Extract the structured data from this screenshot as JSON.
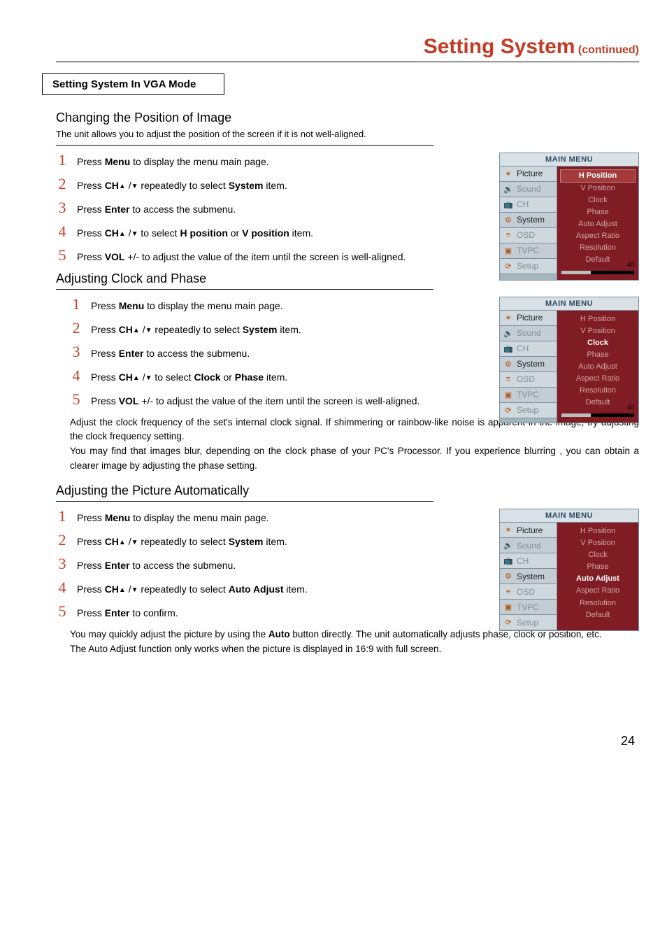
{
  "title": {
    "main": "Setting System",
    "sub": "(continued)"
  },
  "box_heading": "Setting System In VGA Mode",
  "section1": {
    "heading": "Changing the Position of Image",
    "intro": "The unit allows you to adjust the position of the screen if it is not well-aligned."
  },
  "section2": {
    "heading": "Adjusting Clock and Phase",
    "note1": "Adjust the clock frequency of the set's internal clock signal. If shimmering or rainbow-like noise is apparent in the image, try adjusting the clock frequency setting.",
    "note2": "You may find that images blur, depending on the clock phase of your PC's Processor. If you experience blurring , you can obtain a clearer image by adjusting the phase setting."
  },
  "section3": {
    "heading": "Adjusting the Picture Automatically",
    "note1_a": "You may quickly adjust the picture by using the ",
    "note1_bold": "Auto",
    "note1_b": " button directly. The unit automatically adjusts phase, clock or position, etc.",
    "note2": "The Auto Adjust function only works when the picture is displayed in 16:9 with full screen."
  },
  "steps_common": {
    "s1_a": "Press  ",
    "s1_bold": "Menu",
    "s1_b": " to display the menu main page.",
    "s2_a": "Press ",
    "s2_bold1": "CH",
    "s2_mid": " /",
    "s2_b": "  repeatedly to select ",
    "s2_bold2": "System",
    "s2_end": " item.",
    "s3_a": "Press ",
    "s3_bold": "Enter",
    "s3_b": " to access the submenu."
  },
  "steps_s1": {
    "s4_a": "Press  ",
    "s4_bold1": "CH",
    "s4_mid": " /",
    "s4_b": "  to select ",
    "s4_bold2": "H position",
    "s4_or": " or ",
    "s4_bold3": "V position",
    "s4_end": " item.",
    "s5_a": "Press  ",
    "s5_bold": "VOL",
    "s5_b": " +/- to adjust the value of the item until the screen is well-aligned."
  },
  "steps_s2": {
    "s4_a": "Press  ",
    "s4_bold1": "CH",
    "s4_mid": " /",
    "s4_b": "  to select ",
    "s4_bold2": "Clock",
    "s4_or": " or ",
    "s4_bold3": "Phase",
    "s4_end": " item.",
    "s5_a": "Press  ",
    "s5_bold": "VOL",
    "s5_b": " +/- to adjust the value of the item until the screen is well-aligned."
  },
  "steps_s3": {
    "s4_a": "Press ",
    "s4_bold1": "CH",
    "s4_mid": " /",
    "s4_b": "  repeatedly to select  ",
    "s4_bold2": "Auto Adjust",
    "s4_end": "  item.",
    "s5_a": "Press ",
    "s5_bold": "Enter",
    "s5_b": " to confirm."
  },
  "osd": {
    "header": "MAIN MENU",
    "left": [
      "Picture",
      "Sound",
      "CH",
      "System",
      "OSD",
      "TVPC",
      "Setup"
    ],
    "right": [
      "H Position",
      "V Position",
      "Clock",
      "Phase",
      "Auto Adjust",
      "Aspect Ratio",
      "Resolution",
      "Default"
    ],
    "slider_value": "40"
  },
  "menu1_active": "H Position",
  "menu2_active": "Clock",
  "menu3_active": "Auto Adjust",
  "page_number": "24"
}
